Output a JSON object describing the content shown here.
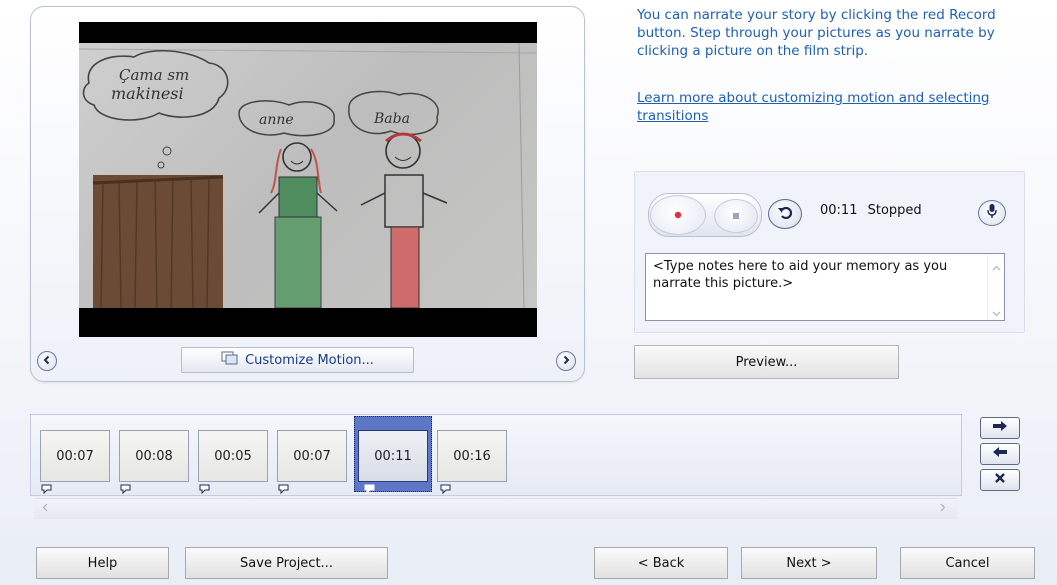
{
  "info": {
    "narration_text": "You can narrate your story by clicking the red Record button. Step through your pictures as you narrate by clicking a picture on the film strip.",
    "learn_more_link": "Learn more about customizing motion and selecting transitions"
  },
  "preview": {
    "customize_motion_label": "Customize Motion..."
  },
  "recorder": {
    "status_time": "00:11",
    "status_state": "Stopped",
    "notes_text": "<Type notes here to aid your memory as you narrate this picture.>"
  },
  "preview_button_label": "Preview...",
  "filmstrip": {
    "frames": [
      {
        "duration": "00:07"
      },
      {
        "duration": "00:08"
      },
      {
        "duration": "00:05"
      },
      {
        "duration": "00:07"
      },
      {
        "duration": "00:11",
        "selected": true
      },
      {
        "duration": "00:16"
      }
    ]
  },
  "footer": {
    "help": "Help",
    "save_project": "Save Project...",
    "back": "< Back",
    "next": "Next >",
    "cancel": "Cancel"
  },
  "colors": {
    "link": "#1f5fb5",
    "record_red": "#e0303a",
    "selection": "#5d76c6"
  }
}
